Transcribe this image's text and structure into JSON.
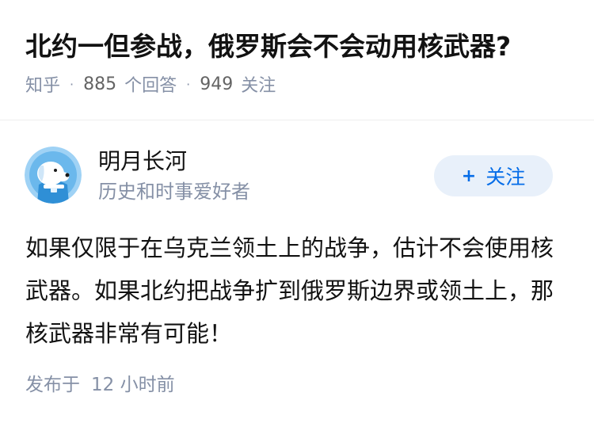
{
  "question": {
    "title": "北约一但参战，俄罗斯会不会动用核武器?",
    "source": "知乎",
    "separator": "·",
    "answer_count": "885",
    "answer_label": "个回答",
    "follower_count": "949",
    "follower_label": "关注"
  },
  "answer": {
    "author": {
      "name": "明月长河",
      "bio": "历史和时事爱好者",
      "avatar_icon": "dog-mascot-avatar-icon"
    },
    "follow": {
      "plus": "+",
      "label": "关注"
    },
    "content": "如果仅限于在乌克兰领土上的战争，估计不会使用核武器。如果北约把战争扩到俄罗斯边界或领土上，那核武器非常有可能！",
    "published_label": "发布于",
    "published_time": "12 小时前"
  },
  "colors": {
    "title": "#121212",
    "meta": "#8590a6",
    "accent": "#056de8",
    "follow_bg": "#e8f0fa"
  }
}
